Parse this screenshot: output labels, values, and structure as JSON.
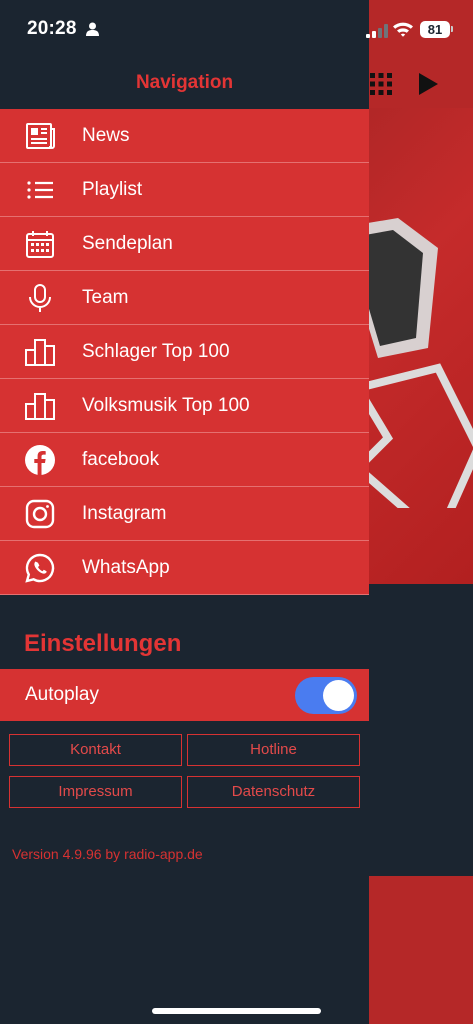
{
  "status_bar": {
    "time": "20:28",
    "battery": "81"
  },
  "drawer": {
    "title": "Navigation",
    "items": [
      {
        "label": "News",
        "icon": "newspaper-icon"
      },
      {
        "label": "Playlist",
        "icon": "list-icon"
      },
      {
        "label": "Sendeplan",
        "icon": "calendar-icon"
      },
      {
        "label": "Team",
        "icon": "microphone-icon"
      },
      {
        "label": "Schlager Top 100",
        "icon": "chart-bars-icon"
      },
      {
        "label": "Volksmusik Top 100",
        "icon": "chart-bars-icon"
      },
      {
        "label": "facebook",
        "icon": "facebook-icon"
      },
      {
        "label": "Instagram",
        "icon": "instagram-icon"
      },
      {
        "label": "WhatsApp",
        "icon": "whatsapp-icon"
      }
    ],
    "settings_title": "Einstellungen",
    "autoplay": {
      "label": "Autoplay",
      "enabled": true
    },
    "buttons": {
      "kontakt": "Kontakt",
      "hotline": "Hotline",
      "impressum": "Impressum",
      "datenschutz": "Datenschutz"
    },
    "version": "Version 4.9.96 by radio-app.de"
  },
  "colors": {
    "drawer_bg": "#1b2530",
    "accent_red": "#d63232",
    "title_red": "#e33535",
    "toggle_on": "#4a7cf0"
  }
}
